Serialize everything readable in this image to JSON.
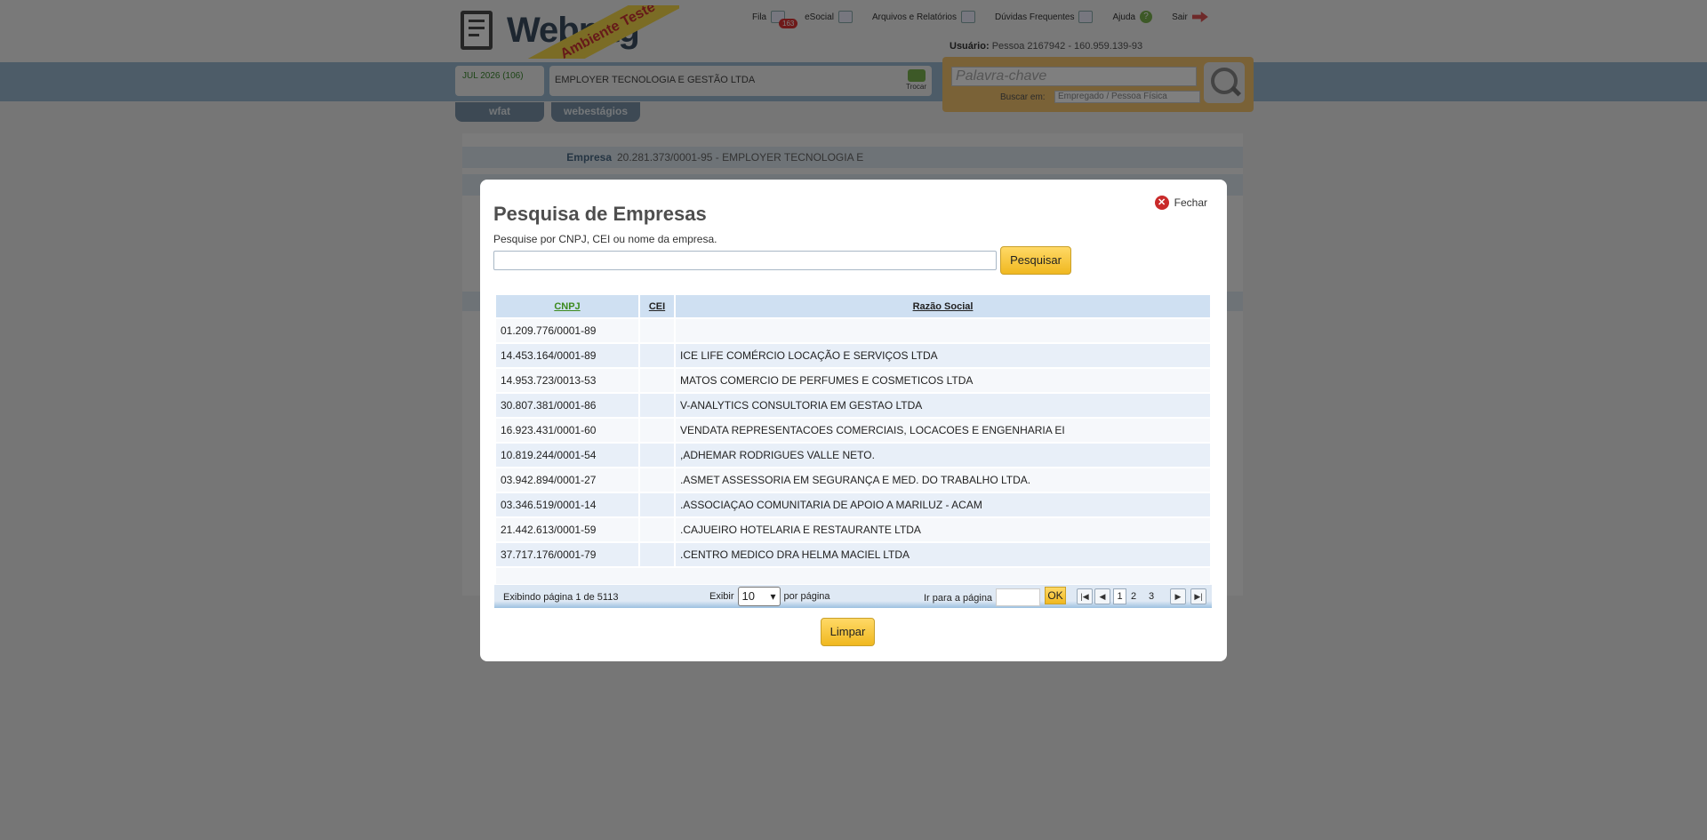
{
  "header": {
    "logo_text": "Webpag",
    "env_ribbon": "Ambiente Teste",
    "nav": [
      {
        "label": "Fila",
        "icon": "queue-icon"
      },
      {
        "label": "eSocial",
        "icon": "esocial-icon"
      },
      {
        "label": "Arquivos e Relatórios",
        "icon": "files-icon"
      },
      {
        "label": "Dúvidas Frequentes",
        "icon": "faq-icon"
      },
      {
        "label": "Ajuda",
        "icon": "help-icon"
      },
      {
        "label": "Sair",
        "icon": "exit-icon"
      }
    ],
    "queue_badge": "163",
    "user_label": "Usuário:",
    "user_value": "Pessoa 2167942 - 160.959.139-93",
    "period": "JUL 2026 (106)",
    "company": "EMPLOYER TECNOLOGIA E GESTÃO LTDA",
    "trocar": "Trocar",
    "keyword_placeholder": "Palavra-chave",
    "search_in_label": "Buscar em:",
    "search_in_value": "Empregado / Pessoa Física",
    "tabs": [
      "wfat",
      "webestágios"
    ]
  },
  "background": {
    "empresa_label": "Empresa",
    "empresa_value": "20.281.373/0001-95 - EMPLOYER TECNOLOGIA E"
  },
  "modal": {
    "title": "Pesquisa de Empresas",
    "close_label": "Fechar",
    "instruction": "Pesquise por CNPJ, CEI ou nome da empresa.",
    "search_value": "",
    "search_button": "Pesquisar",
    "columns": [
      "CNPJ",
      "CEI",
      "Razão Social"
    ],
    "rows": [
      {
        "cnpj": "01.209.776/0001-89",
        "cei": "",
        "razao": ""
      },
      {
        "cnpj": "14.453.164/0001-89",
        "cei": "",
        "razao": "ICE LIFE COMÉRCIO LOCAÇÃO E SERVIÇOS LTDA"
      },
      {
        "cnpj": "14.953.723/0013-53",
        "cei": "",
        "razao": "MATOS COMERCIO DE PERFUMES E COSMETICOS LTDA"
      },
      {
        "cnpj": "30.807.381/0001-86",
        "cei": "",
        "razao": "V-ANALYTICS CONSULTORIA EM GESTAO LTDA"
      },
      {
        "cnpj": "16.923.431/0001-60",
        "cei": "",
        "razao": "VENDATA REPRESENTACOES COMERCIAIS, LOCACOES E ENGENHARIA EI"
      },
      {
        "cnpj": "10.819.244/0001-54",
        "cei": "",
        "razao": ",ADHEMAR RODRIGUES VALLE NETO."
      },
      {
        "cnpj": "03.942.894/0001-27",
        "cei": "",
        "razao": ".ASMET ASSESSORIA EM SEGURANÇA E MED. DO TRABALHO LTDA."
      },
      {
        "cnpj": "03.346.519/0001-14",
        "cei": "",
        "razao": ".ASSOCIAÇAO COMUNITARIA DE APOIO A MARILUZ - ACAM"
      },
      {
        "cnpj": "21.442.613/0001-59",
        "cei": "",
        "razao": ".CAJUEIRO HOTELARIA E RESTAURANTE LTDA"
      },
      {
        "cnpj": "37.717.176/0001-79",
        "cei": "",
        "razao": ".CENTRO MEDICO DRA HELMA MACIEL LTDA"
      }
    ],
    "pager": {
      "info": "Exibindo página 1 de 5113",
      "show_label": "Exibir",
      "per_page": "10",
      "per_page_suffix": "por página",
      "goto_label": "Ir para a página",
      "ok": "OK",
      "pages": [
        "1",
        "2",
        "3"
      ],
      "current": "1"
    },
    "clear_button": "Limpar"
  }
}
